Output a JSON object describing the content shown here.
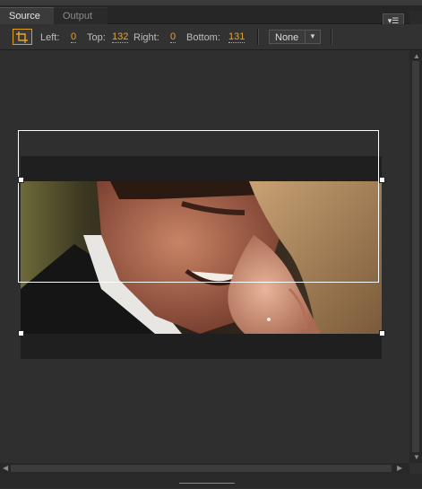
{
  "tabs": [
    {
      "label": "Source",
      "active": true
    },
    {
      "label": "Output",
      "active": false
    }
  ],
  "panel_menu_icon": "panel-menu-icon",
  "toolbar": {
    "crop_icon": "crop-icon",
    "left_label": "Left:",
    "left_value": "0",
    "top_label": "Top:",
    "top_value": "132",
    "right_label": "Right:",
    "right_value": "0",
    "bottom_label": "Bottom:",
    "bottom_value": "131",
    "aspect_dropdown_value": "None"
  },
  "colors": {
    "accent": "#e5a52a",
    "panel_bg": "#2f2f2f",
    "crop_outline": "#ffffff"
  }
}
